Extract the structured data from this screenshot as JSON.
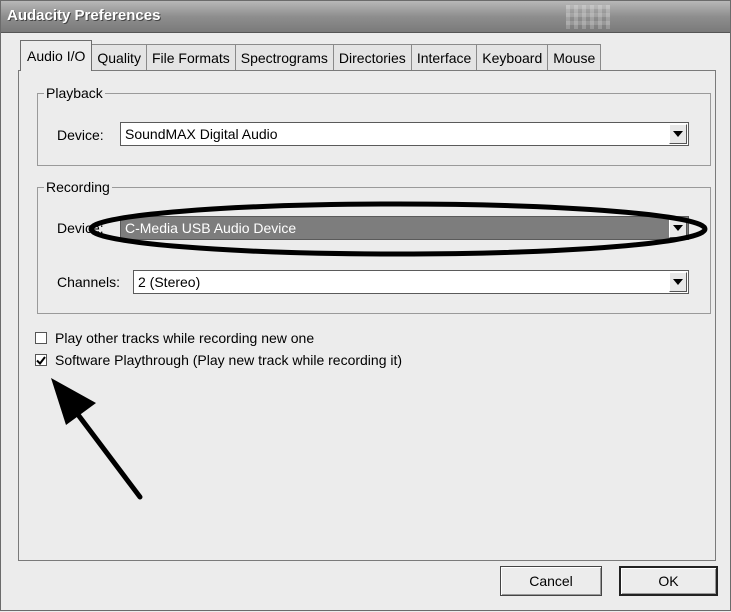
{
  "window": {
    "title": "Audacity Preferences"
  },
  "tabs": [
    {
      "label": "Audio I/O"
    },
    {
      "label": "Quality"
    },
    {
      "label": "File Formats"
    },
    {
      "label": "Spectrograms"
    },
    {
      "label": "Directories"
    },
    {
      "label": "Interface"
    },
    {
      "label": "Keyboard"
    },
    {
      "label": "Mouse"
    }
  ],
  "playback": {
    "group_label": "Playback",
    "device_label": "Device:",
    "device_value": "SoundMAX Digital Audio"
  },
  "recording": {
    "group_label": "Recording",
    "device_label": "Device:",
    "device_value": "C-Media USB Audio Device",
    "channels_label": "Channels:",
    "channels_value": "2 (Stereo)"
  },
  "options": {
    "play_other_tracks": {
      "label": "Play other tracks while recording new one",
      "checked": false
    },
    "software_playthrough": {
      "label": "Software Playthrough (Play new track while recording it)",
      "checked": true
    }
  },
  "buttons": {
    "cancel": "Cancel",
    "ok": "OK"
  }
}
